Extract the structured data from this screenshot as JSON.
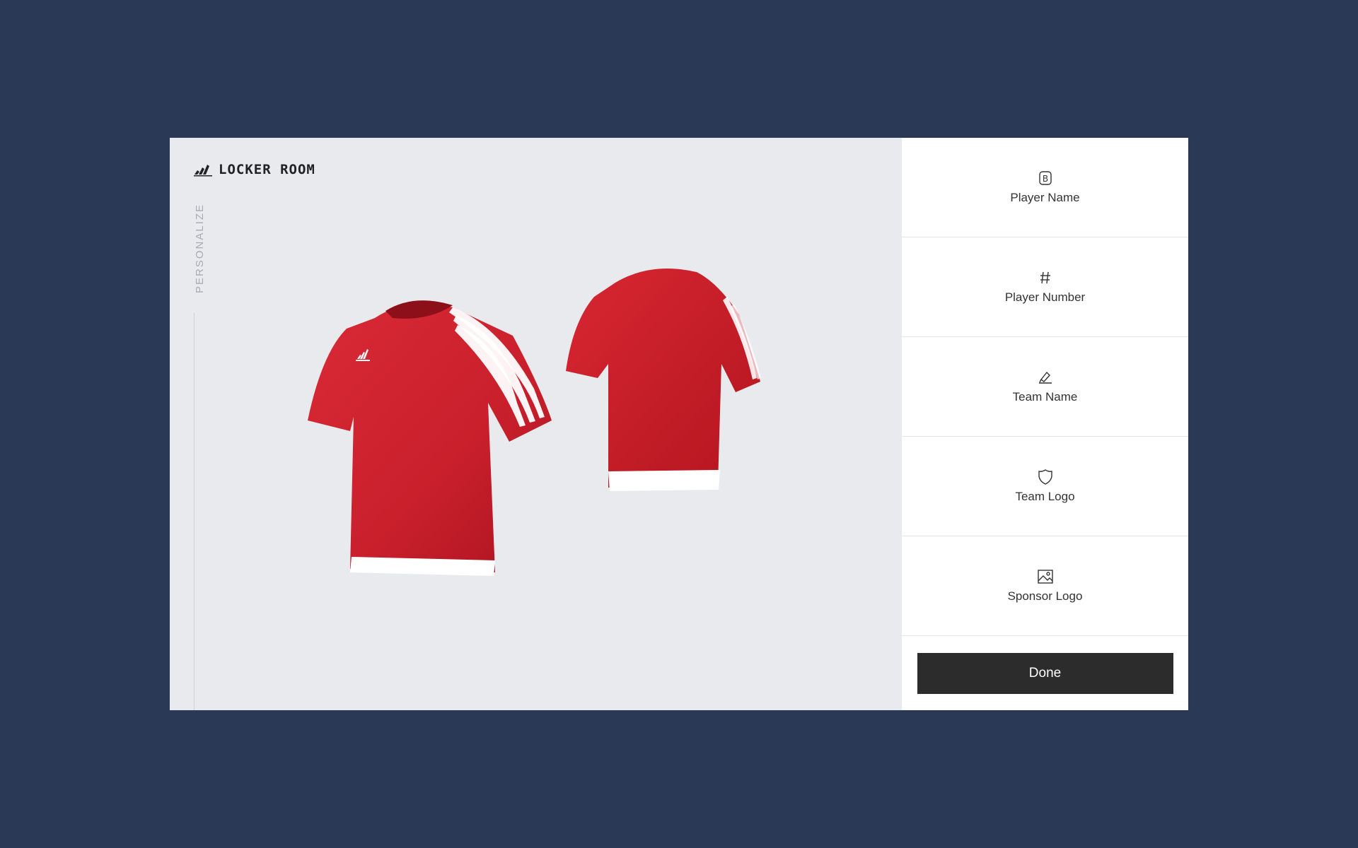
{
  "app": {
    "brand_title": "LOCKER ROOM",
    "section_label": "PERSONALIZE"
  },
  "options": [
    {
      "label": "Player Name",
      "icon": "letter-b-icon"
    },
    {
      "label": "Player Number",
      "icon": "hash-icon"
    },
    {
      "label": "Team Name",
      "icon": "team-name-icon"
    },
    {
      "label": "Team Logo",
      "icon": "shield-icon"
    },
    {
      "label": "Sponsor Logo",
      "icon": "image-icon"
    }
  ],
  "done_label": "Done",
  "colors": {
    "background": "#2a3a56",
    "jersey_red": "#d3202f",
    "button_dark": "#2c2c2c"
  }
}
